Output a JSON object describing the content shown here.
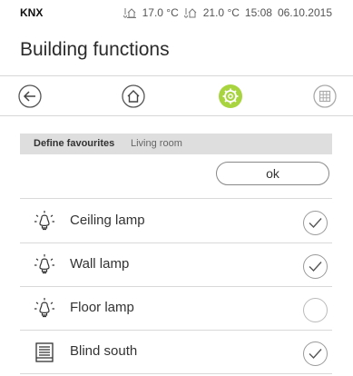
{
  "status": {
    "brand": "KNX",
    "outdoor_temp": "17.0 °C",
    "indoor_temp": "21.0 °C",
    "time": "15:08",
    "date": "06.10.2015"
  },
  "header": {
    "title": "Building functions"
  },
  "toolbar": {
    "buttons": [
      {
        "icon": "back-arrow-icon"
      },
      {
        "icon": "home-icon"
      },
      {
        "icon": "gear-icon",
        "active": true,
        "color": "#a8d43f"
      },
      {
        "icon": "grid-icon",
        "disabled": true
      }
    ]
  },
  "panel": {
    "title": "Define favourites",
    "room": "Living room",
    "ok_label": "ok",
    "items": [
      {
        "label": "Ceiling lamp",
        "icon": "lamp-icon",
        "checked": true
      },
      {
        "label": "Wall lamp",
        "icon": "lamp-icon",
        "checked": true
      },
      {
        "label": "Floor lamp",
        "icon": "lamp-icon",
        "checked": false
      },
      {
        "label": "Blind south",
        "icon": "blind-icon",
        "checked": true
      }
    ]
  },
  "colors": {
    "accent": "#a8d43f",
    "header_bg": "#dedede"
  }
}
